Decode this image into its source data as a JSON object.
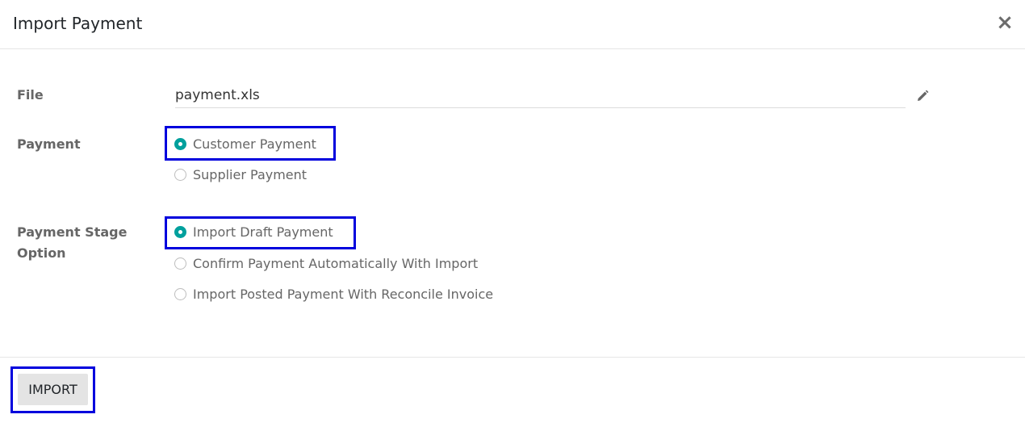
{
  "dialog": {
    "title": "Import Payment",
    "close_icon": "close-icon"
  },
  "fields": {
    "file": {
      "label": "File",
      "value": "payment.xls",
      "edit_icon": "pencil-icon"
    },
    "payment": {
      "label": "Payment",
      "options": [
        {
          "label": "Customer Payment",
          "checked": true
        },
        {
          "label": "Supplier Payment",
          "checked": false
        }
      ]
    },
    "stage": {
      "label": "Payment Stage Option",
      "options": [
        {
          "label": "Import Draft Payment",
          "checked": true
        },
        {
          "label": "Confirm Payment Automatically With Import",
          "checked": false
        },
        {
          "label": "Import Posted Payment With Reconcile Invoice",
          "checked": false
        }
      ]
    }
  },
  "footer": {
    "import_label": "IMPORT"
  },
  "colors": {
    "accent": "#00a09d",
    "highlight": "#0000dd"
  }
}
